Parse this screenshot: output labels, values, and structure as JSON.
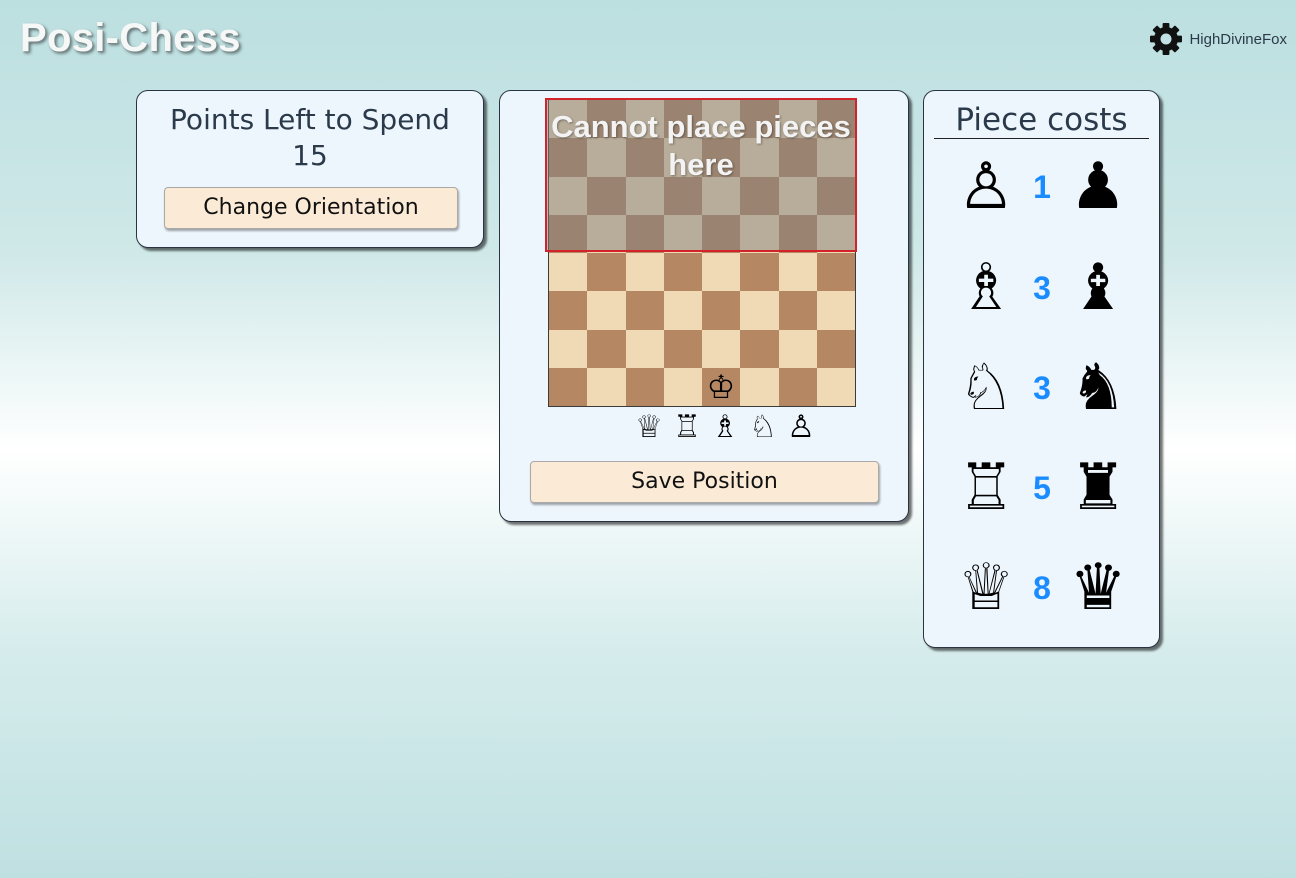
{
  "header": {
    "logo": "Posi-Chess",
    "username": "HighDivineFox",
    "settings_icon": "gear-icon"
  },
  "points_panel": {
    "title": "Points Left to Spend",
    "value": "15",
    "button_label": "Change Orientation"
  },
  "board_panel": {
    "overlay_text": "Cannot place pieces here",
    "king_symbol": "♔",
    "tray": [
      "♕",
      "♖",
      "♗",
      "♘",
      "♙"
    ],
    "save_label": "Save Position",
    "colors": {
      "light": "#f0d9b5",
      "dark": "#b58863",
      "overlay_border": "#d2232a"
    }
  },
  "cost_panel": {
    "title": "Piece costs",
    "accent": "#1a8cff",
    "rows": [
      {
        "piece": "pawn",
        "white": "♙",
        "black": "♟",
        "cost": "1"
      },
      {
        "piece": "bishop",
        "white": "♗",
        "black": "♝",
        "cost": "3"
      },
      {
        "piece": "knight",
        "white": "♘",
        "black": "♞",
        "cost": "3"
      },
      {
        "piece": "rook",
        "white": "♖",
        "black": "♜",
        "cost": "5"
      },
      {
        "piece": "queen",
        "white": "♕",
        "black": "♛",
        "cost": "8"
      }
    ]
  }
}
